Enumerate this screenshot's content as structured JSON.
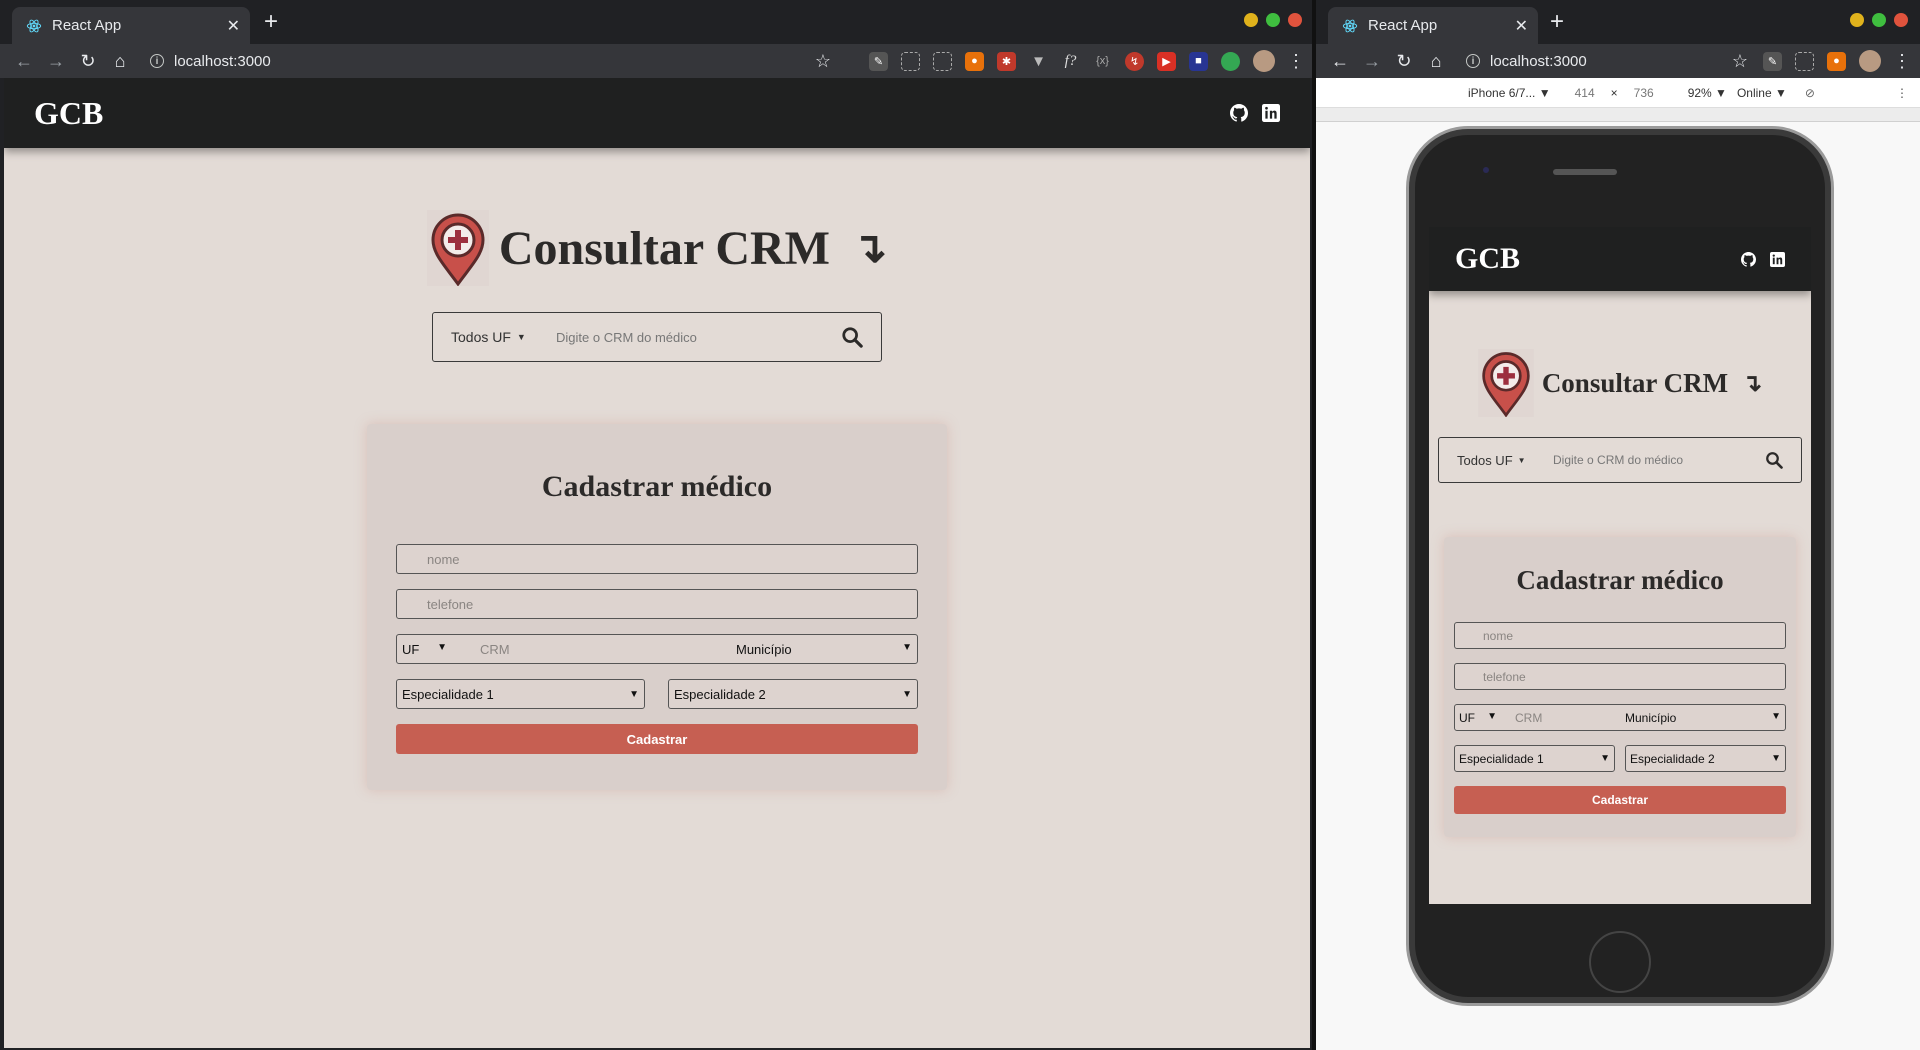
{
  "left_window": {
    "tab_title": "React App",
    "url": "localhost:3000",
    "app": {
      "brand": "GCB",
      "hero_title": "Consultar CRM",
      "hero_arrow": "↴",
      "search": {
        "uf_label": "Todos UF",
        "placeholder": "Digite o CRM do médico"
      },
      "form": {
        "title": "Cadastrar médico",
        "nome_placeholder": "nome",
        "telefone_placeholder": "telefone",
        "uf_label": "UF",
        "crm_placeholder": "CRM",
        "municipio_label": "Município",
        "especialidade1_label": "Especialidade 1",
        "especialidade2_label": "Especialidade 2",
        "submit_label": "Cadastrar"
      }
    }
  },
  "right_window": {
    "tab_title": "React App",
    "url": "localhost:3000",
    "devtools": {
      "device": "iPhone 6/7...",
      "width": "414",
      "times": "×",
      "height": "736",
      "zoom": "92%",
      "network": "Online"
    },
    "app": {
      "brand": "GCB",
      "hero_title": "Consultar CRM",
      "hero_arrow": "↴",
      "search": {
        "uf_label": "Todos UF",
        "placeholder": "Digite o CRM do médico"
      },
      "form": {
        "title": "Cadastrar médico",
        "nome_placeholder": "nome",
        "telefone_placeholder": "telefone",
        "uf_label": "UF",
        "crm_placeholder": "CRM",
        "municipio_label": "Município",
        "especialidade1_label": "Especialidade 1",
        "especialidade2_label": "Especialidade 2",
        "submit_label": "Cadastrar"
      }
    }
  },
  "colors": {
    "page_bg": "#e3dbd6",
    "appbar_bg": "#1f2020",
    "accent_button": "#c65f52",
    "card_bg": "#d9cfcb"
  },
  "icons": [
    "react-icon",
    "back-arrow-icon",
    "forward-arrow-icon",
    "reload-icon",
    "home-icon",
    "info-icon",
    "star-icon",
    "github-icon",
    "linkedin-icon",
    "search-icon",
    "map-pin-medical-icon",
    "menu-dots-icon"
  ]
}
